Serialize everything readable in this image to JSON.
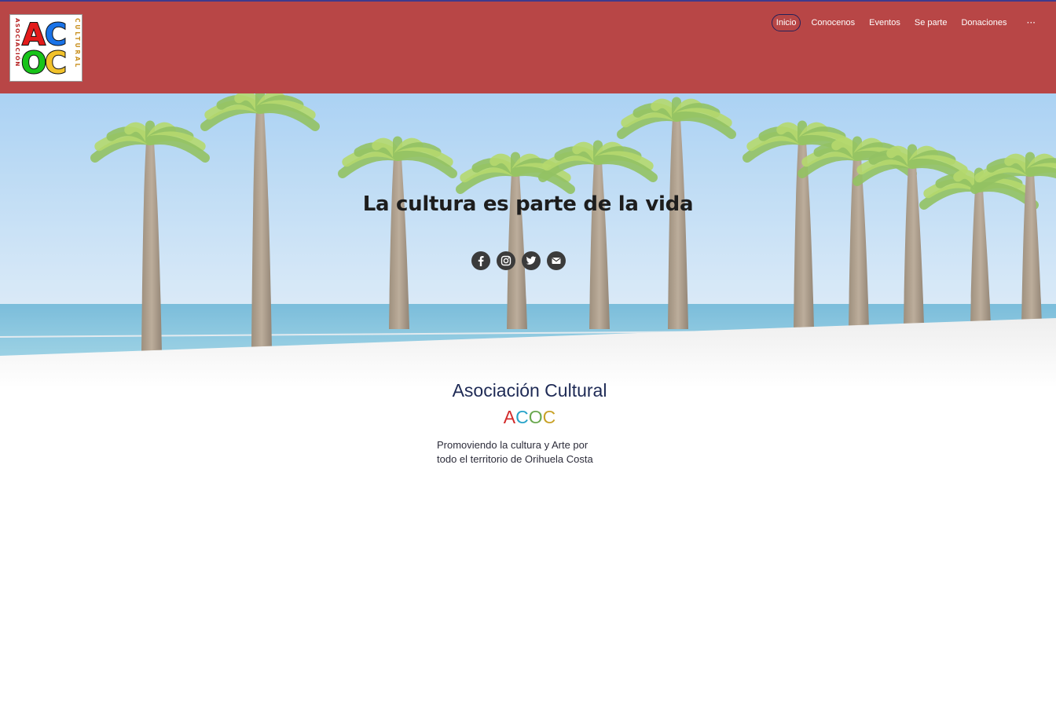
{
  "logo": {
    "letters": [
      "A",
      "C",
      "O",
      "C"
    ],
    "letter_colors": [
      "#e31b1b",
      "#1a73e8",
      "#18c41a",
      "#f2c22b"
    ],
    "left_word": "ASOCIACIÓN",
    "right_word": "CULTURAL"
  },
  "nav": {
    "items": [
      {
        "label": "Inicio",
        "active": true
      },
      {
        "label": "Conocenos"
      },
      {
        "label": "Eventos"
      },
      {
        "label": "Se parte"
      },
      {
        "label": "Donaciones"
      }
    ],
    "more_label": "···"
  },
  "hero": {
    "title": "La cultura es parte de la vida",
    "social_icons": [
      "facebook-icon",
      "instagram-icon",
      "twitter-icon",
      "email-icon"
    ]
  },
  "intro": {
    "title": "Asociación Cultural",
    "acronym": [
      "A",
      "C",
      "O",
      "C"
    ],
    "acronym_colors": [
      "#d22b2b",
      "#26a3c9",
      "#6aa84f",
      "#c9a227"
    ],
    "description_line1": "Promoviendo la cultura y Arte por",
    "description_line2": "todo el territorio de Orihuela Costa"
  },
  "colors": {
    "header_bg": "#b84646",
    "active_border": "#23215a",
    "title_color": "#1e2a55"
  }
}
